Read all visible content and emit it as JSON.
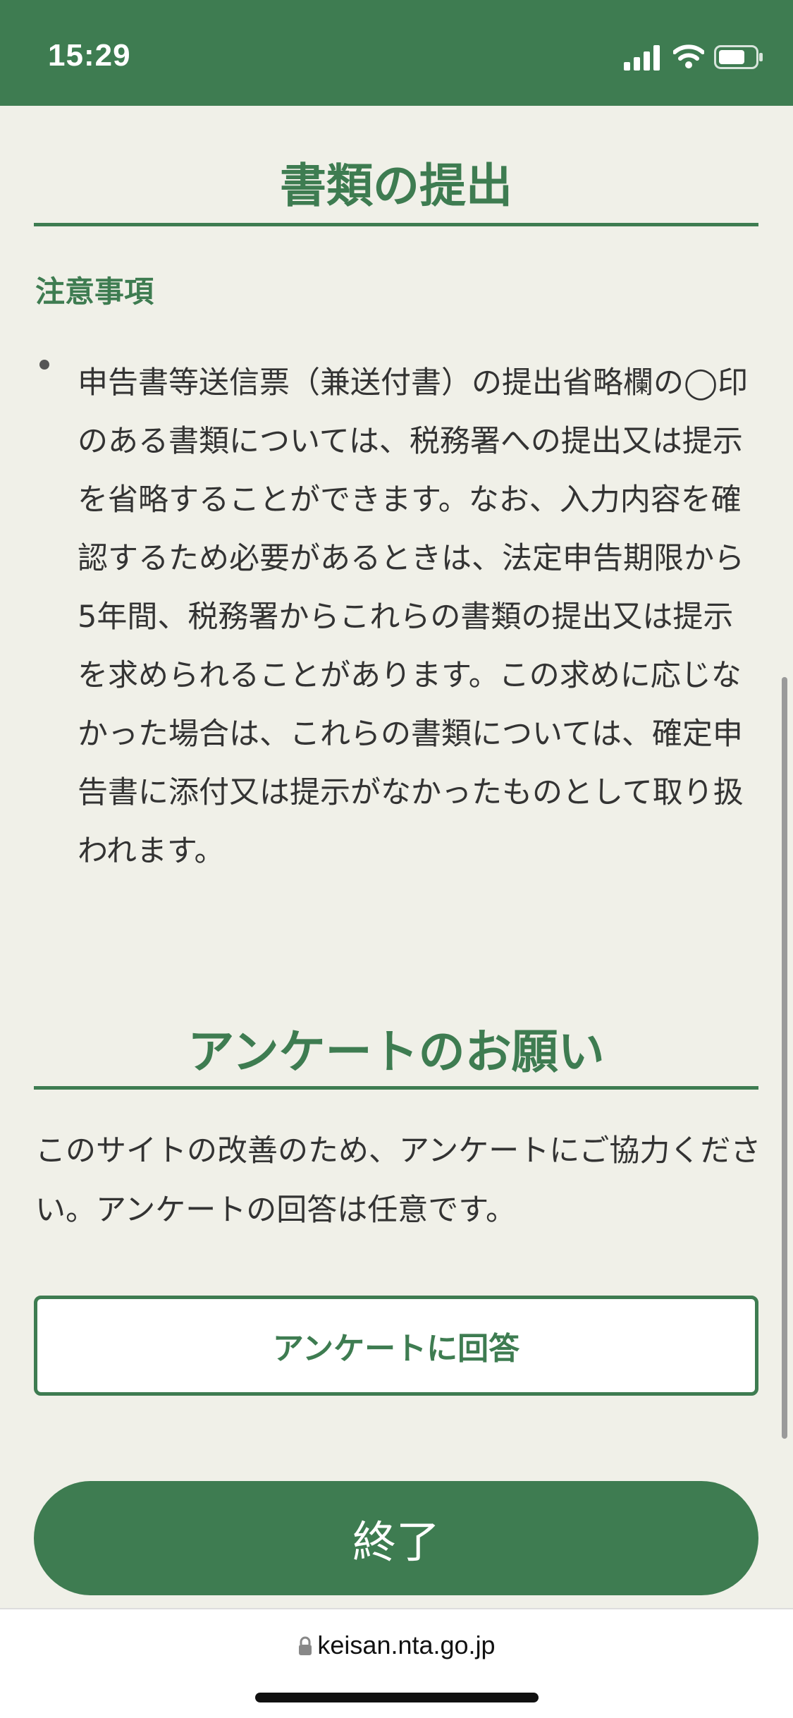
{
  "status_bar": {
    "time": "15:29",
    "icons": [
      "signal-icon",
      "wifi-icon",
      "battery-icon"
    ]
  },
  "submission": {
    "title": "書類の提出",
    "notice_heading": "注意事項",
    "notice_body": "申告書等送信票（兼送付書）の提出省略欄の◯印のある書類については、税務署への提出又は提示を省略することができます。なお、入力内容を確認するため必要があるときは、法定申告期限から5年間、税務署からこれらの書類の提出又は提示を求められることがあります。この求めに応じなかった場合は、これらの書類については、確定申告書に添付又は提示がなかったものとして取り扱われます。"
  },
  "survey": {
    "title": "アンケートのお願い",
    "description": "このサイトの改善のため、アンケートにご協力ください。アンケートの回答は任意です。",
    "button_label": "アンケートに回答"
  },
  "finish_button_label": "終了",
  "url_bar": {
    "url": "keisan.nta.go.jp",
    "icon": "lock-icon"
  },
  "colors": {
    "brand_green": "#3e7c51",
    "background": "#f0f0e8",
    "text": "#333333"
  }
}
